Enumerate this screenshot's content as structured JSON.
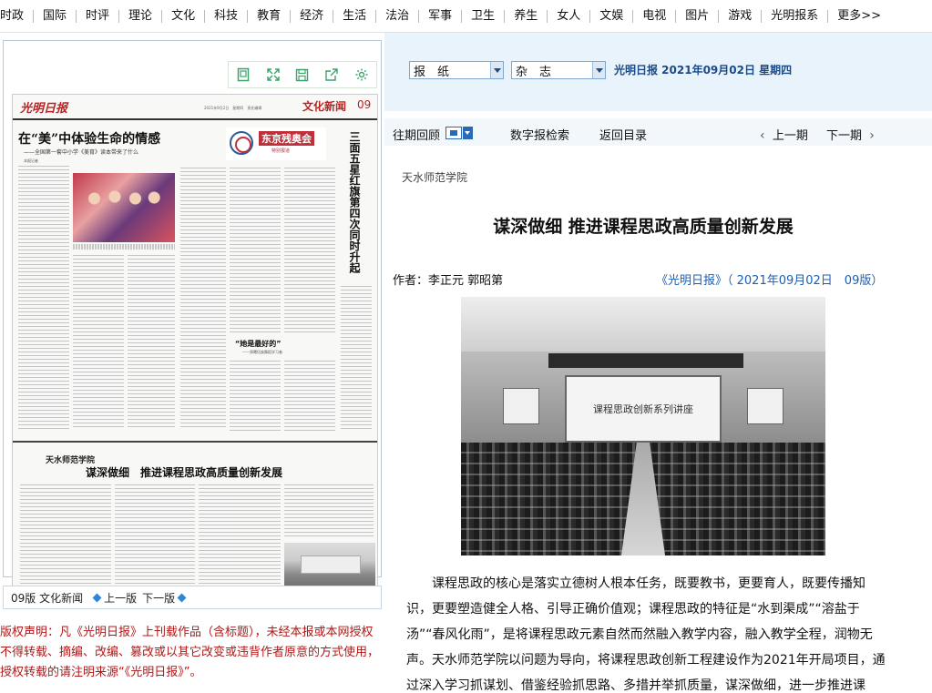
{
  "nav": [
    "时政",
    "国际",
    "时评",
    "理论",
    "文化",
    "科技",
    "教育",
    "经济",
    "生活",
    "法治",
    "军事",
    "卫生",
    "养生",
    "女人",
    "文娱",
    "电视",
    "图片",
    "游戏",
    "光明报系",
    "更多>>"
  ],
  "paper": {
    "logo": "光明日报",
    "dateline": "2021年9月2日　星期四　责任编辑",
    "section": "文化新闻",
    "page_no": "09",
    "headline_1": "在“美”中体验生命的情感",
    "headline_1_sub": "——全国第一套中小学《美育》读本带来了什么",
    "author_1": "本报记者　　　　　　　　　　　　　　",
    "ad_title": "东京残奥会",
    "ad_sub": "特别报道",
    "vertical_headline": "三面五星红旗第四次同时升起",
    "quote_head": "“她是最好的”",
    "quote_sub": "——郑曦伍族舞蹈学习者",
    "school": "天水师范学院",
    "headline_2": "谋深做细　推进课程思政高质量创新发展"
  },
  "pager": {
    "edition": "09版 文化新闻",
    "prev": "上一版",
    "next": "下一版"
  },
  "copyright": "版权声明：凡《光明日报》上刊载作品（含标题），未经本报或本网授权不得转载、摘编、改编、篡改或以其它改变或违背作者原意的方式使用，授权转载的请注明来源“《光明日报》”。",
  "selects": {
    "newspaper": "报　纸",
    "magazine": "杂　志"
  },
  "date_label": "光明日报 2021年09月02日 星期四",
  "toolbar": {
    "archive": "往期回顾",
    "digital_search": "数字报检索",
    "back_to_toc": "返回目录",
    "prev_issue": "上一期",
    "next_issue": "下一期"
  },
  "article": {
    "school": "天水师范学院",
    "title": "谋深做细 推进课程思政高质量创新发展",
    "author": "作者：李正元 郭昭第",
    "source": "《光明日报》（ 2021年09月02日　09版）",
    "photo_screen_text": "课程思政创新系列讲座",
    "body": "课程思政的核心是落实立德树人根本任务，既要教书，更要育人，既要传播知识，更要塑造健全人格、引导正确价值观；课程思政的特征是“水到渠成”“溶盐于汤”“春风化雨”，是将课程思政元素自然而然融入教学内容，融入教学全程，润物无声。天水师范学院以问题为导向，将课程思政创新工程建设作为2021年开局项目，通过深入学习抓谋划、借鉴经验抓思路、多措并举抓质量，谋深做细，进一步推进课"
  }
}
